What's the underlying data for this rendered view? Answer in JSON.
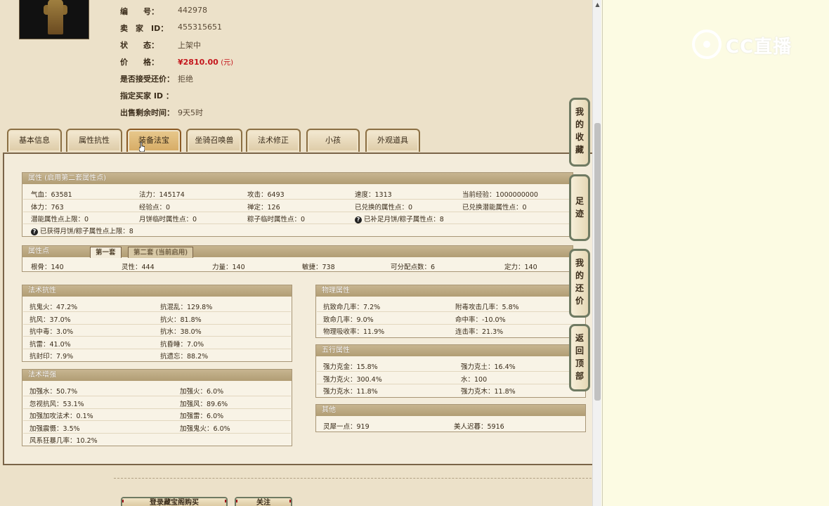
{
  "seller_info": {
    "number_label": "编　　号：",
    "number": "442978",
    "seller_label": "卖　家　ID：",
    "seller_id": "455315651",
    "status_label": "状　　态：",
    "status": "上架中",
    "price_label": "价　　格：",
    "price": "¥2810.00",
    "price_unit": "(元)",
    "bargain_label": "是否接受还价：",
    "bargain": "拒绝",
    "buyer_label": "指定买家 ID ：",
    "buyer": "",
    "time_label": "出售剩余时间：",
    "time_left": "9天5时"
  },
  "tabs": [
    "基本信息",
    "属性抗性",
    "装备法宝",
    "坐骑召唤兽",
    "法术修正",
    "小孩",
    "外观道具"
  ],
  "active_tab": "装备法宝",
  "attr_box": {
    "title": "属性 (启用第二套属性点)",
    "row1": [
      "气血：63581",
      "法力：145174",
      "攻击：6493",
      "速度：1313",
      "当前经验：1000000000"
    ],
    "row2": [
      "体力：763",
      "经验点：0",
      "禅定：126",
      "已兑换的属性点：0",
      "已兑换潜能属性点：0"
    ],
    "row3": [
      "潜能属性点上限：0",
      "月饼临时属性点：0",
      "粽子临时属性点：0",
      "已补足月饼/粽子属性点：8"
    ],
    "row4": [
      "已获得月饼/粽子属性点上限：8"
    ],
    "q_mark": "?"
  },
  "points_box": {
    "title": "属性点",
    "subtab1": "第一套",
    "subtab2": "第二套 (当前启用)",
    "values": [
      "根骨：140",
      "灵性：444",
      "力量：140",
      "敏捷：738",
      "可分配点数：6",
      "定力：140"
    ]
  },
  "spell_resist": {
    "title": "法术抗性",
    "rows": [
      [
        "抗鬼火：47.2%",
        "抗混乱：129.8%"
      ],
      [
        "抗风：37.0%",
        "抗火：81.8%"
      ],
      [
        "抗中毒：3.0%",
        "抗水：38.0%"
      ],
      [
        "抗雷：41.0%",
        "抗昏睡：7.0%"
      ],
      [
        "抗封印：7.9%",
        "抗遗忘：88.2%"
      ]
    ]
  },
  "spell_boost": {
    "title": "法术增强",
    "rows": [
      [
        "加强水：50.7%",
        "加强火：6.0%"
      ],
      [
        "忽视抗风：53.1%",
        "加强风：89.6%"
      ],
      [
        "加强加攻法术：0.1%",
        "加强雷：6.0%"
      ],
      [
        "加强震慑：3.5%",
        "加强鬼火：6.0%"
      ],
      [
        "风系狂暴几率：10.2%",
        ""
      ]
    ]
  },
  "physical": {
    "title": "物理属性",
    "rows": [
      [
        "抗致命几率：7.2%",
        "附毒攻击几率：5.8%"
      ],
      [
        "致命几率：9.0%",
        "命中率：-10.0%"
      ],
      [
        "物理吸收率：11.9%",
        "连击率：21.3%"
      ]
    ]
  },
  "five_elements": {
    "title": "五行属性",
    "rows": [
      [
        "强力克金：15.8%",
        "强力克土：16.4%"
      ],
      [
        "强力克火：300.4%",
        "水：100"
      ],
      [
        "强力克水：11.8%",
        "强力克木：11.8%"
      ]
    ]
  },
  "other": {
    "title": "其他",
    "rows": [
      [
        "灵犀一点：919",
        "美人迟暮：5916"
      ]
    ]
  },
  "sidebar": {
    "favorites": [
      "我",
      "的",
      "收",
      "藏"
    ],
    "footprints": [
      "足",
      "迹"
    ],
    "my_bargain": [
      "我",
      "的",
      "还",
      "价"
    ],
    "back_top": [
      "返",
      "回",
      "顶",
      "部"
    ]
  },
  "bottom_buttons": [
    "登录藏宝阁购买",
    "关注"
  ],
  "watermark": "CC直播",
  "colors": {
    "price": "#c4161c",
    "panel_bg": "#f3ecdb",
    "header_bg": "#b8a47c"
  }
}
